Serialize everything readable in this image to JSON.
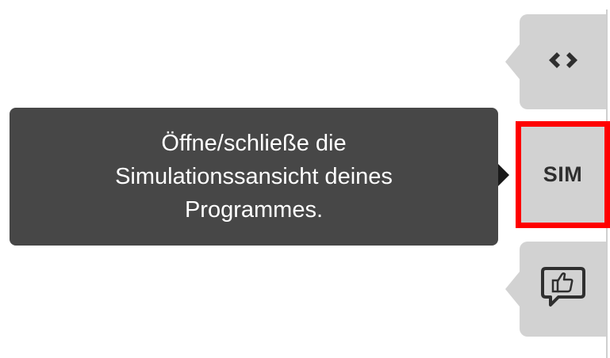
{
  "sidebar": {
    "code_tab": {
      "icon": "code-brackets-icon"
    },
    "sim_tab": {
      "label": "SIM",
      "highlight_color": "#ff0000"
    },
    "feedback_tab": {
      "icon": "thumbs-up-speech-bubble-icon"
    }
  },
  "tooltip": {
    "text": "Öffne/schließe die\nSimulationssansicht deines\nProgrammes."
  }
}
